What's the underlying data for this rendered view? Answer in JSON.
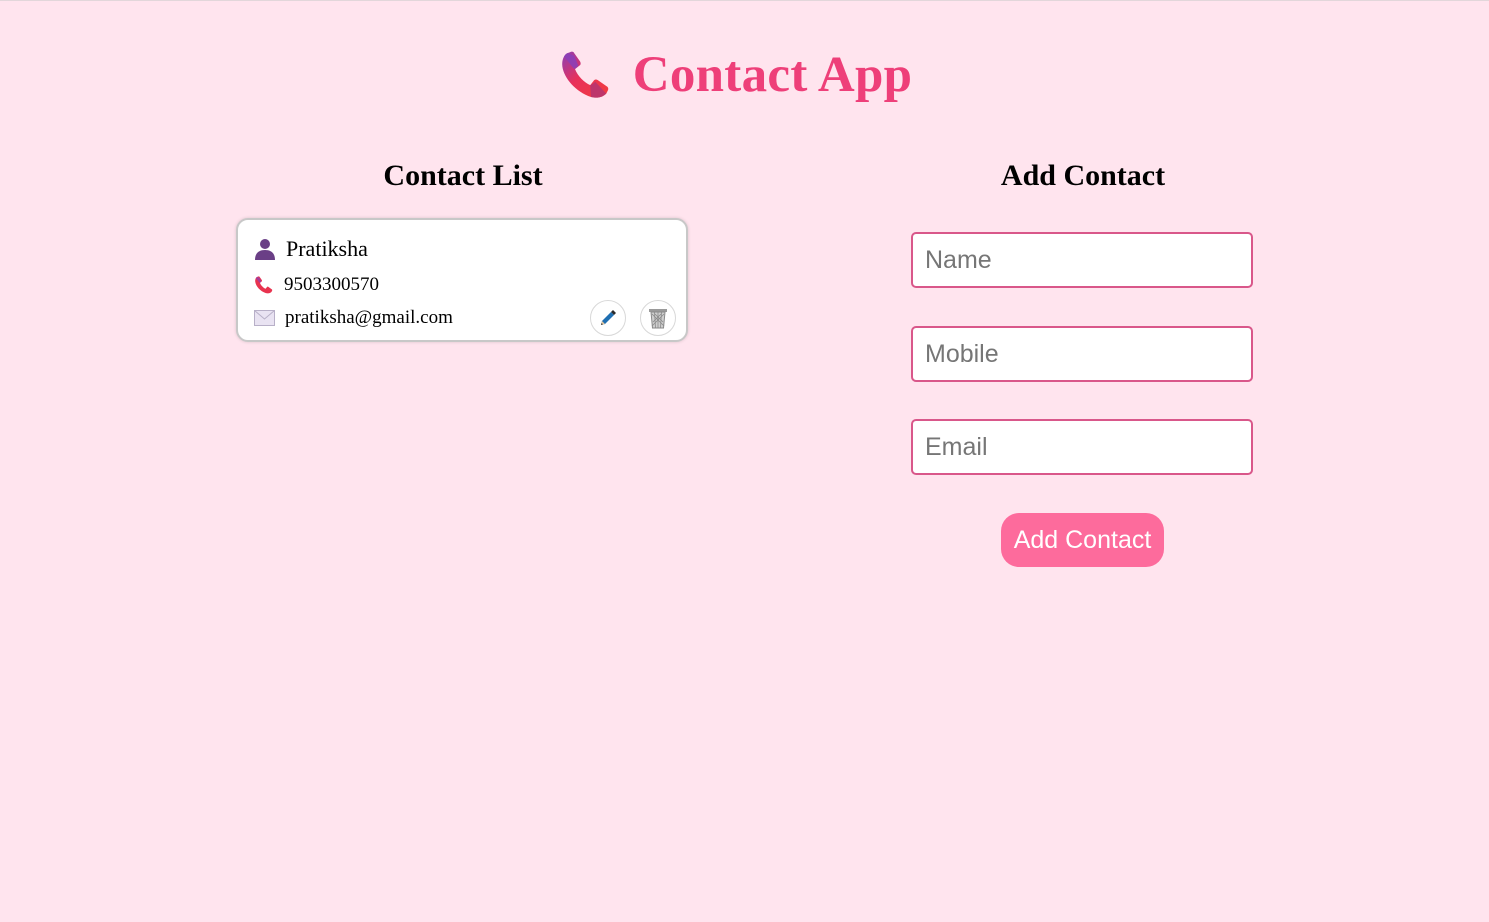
{
  "header": {
    "title": "Contact App",
    "logo_icon": "telephone-receiver-icon"
  },
  "contact_list": {
    "title": "Contact List",
    "contacts": [
      {
        "name": "Pratiksha",
        "mobile": "9503300570",
        "email": "pratiksha@gmail.com"
      }
    ],
    "edit_icon": "pencil-icon",
    "delete_icon": "wastebasket-icon"
  },
  "add_contact": {
    "title": "Add Contact",
    "name_placeholder": "Name",
    "name_value": "",
    "mobile_placeholder": "Mobile",
    "mobile_value": "",
    "email_placeholder": "Email",
    "email_value": "",
    "submit_label": "Add Contact"
  },
  "colors": {
    "background": "#ffe4ee",
    "title": "#ee3f79",
    "input_border": "#d9578a",
    "button": "#fd6b9c"
  }
}
